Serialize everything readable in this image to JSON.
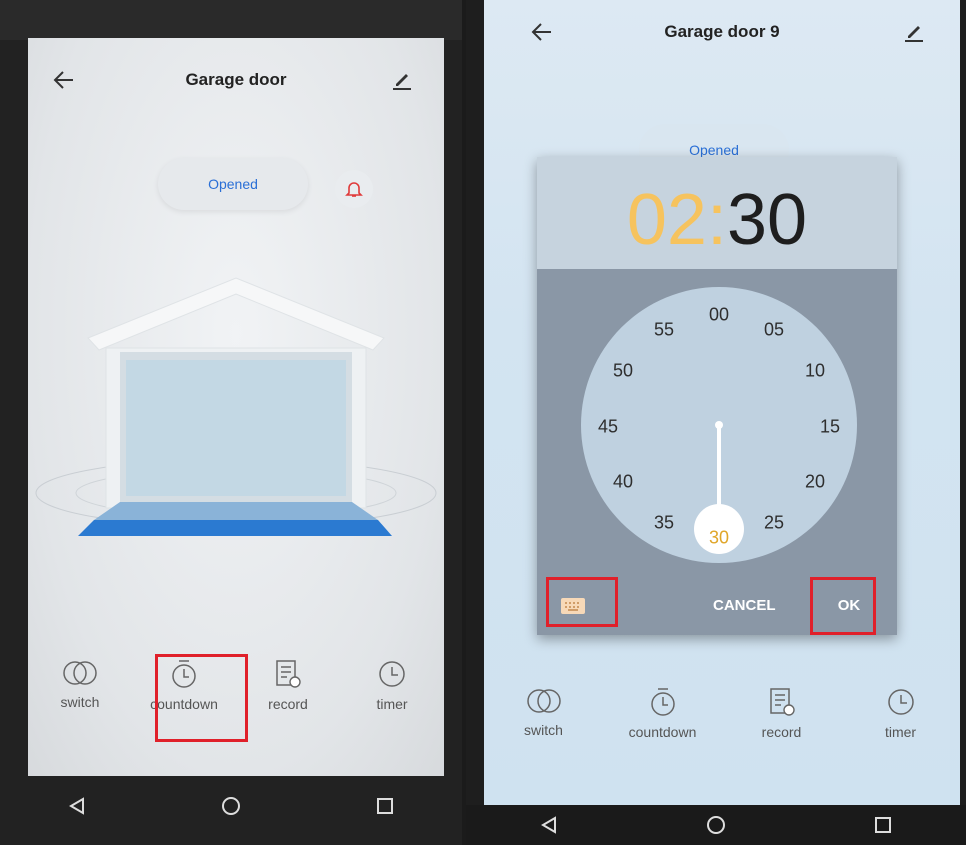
{
  "left": {
    "title": "Garage door",
    "status_label": "Opened",
    "tabs": [
      {
        "label": "switch",
        "icon": "switch-icon"
      },
      {
        "label": "countdown",
        "icon": "countdown-icon"
      },
      {
        "label": "record",
        "icon": "record-icon"
      },
      {
        "label": "timer",
        "icon": "timer-icon"
      }
    ]
  },
  "right": {
    "title": "Garage door 9",
    "status_label": "Opened",
    "dialog": {
      "hours": "02",
      "separator": ":",
      "minutes": "30",
      "clock_numbers": [
        "00",
        "05",
        "10",
        "15",
        "20",
        "25",
        "30",
        "35",
        "40",
        "45",
        "50",
        "55"
      ],
      "selected": "30",
      "cancel_label": "CANCEL",
      "ok_label": "OK"
    },
    "tabs": [
      {
        "label": "switch",
        "icon": "switch-icon"
      },
      {
        "label": "countdown",
        "icon": "countdown-icon"
      },
      {
        "label": "record",
        "icon": "record-icon"
      },
      {
        "label": "timer",
        "icon": "timer-icon"
      }
    ]
  },
  "colors": {
    "accent_blue": "#2a6fd6",
    "alert_red": "#e03a3a",
    "highlight_red": "#e0202a",
    "hours_orange": "#f6c35e"
  }
}
